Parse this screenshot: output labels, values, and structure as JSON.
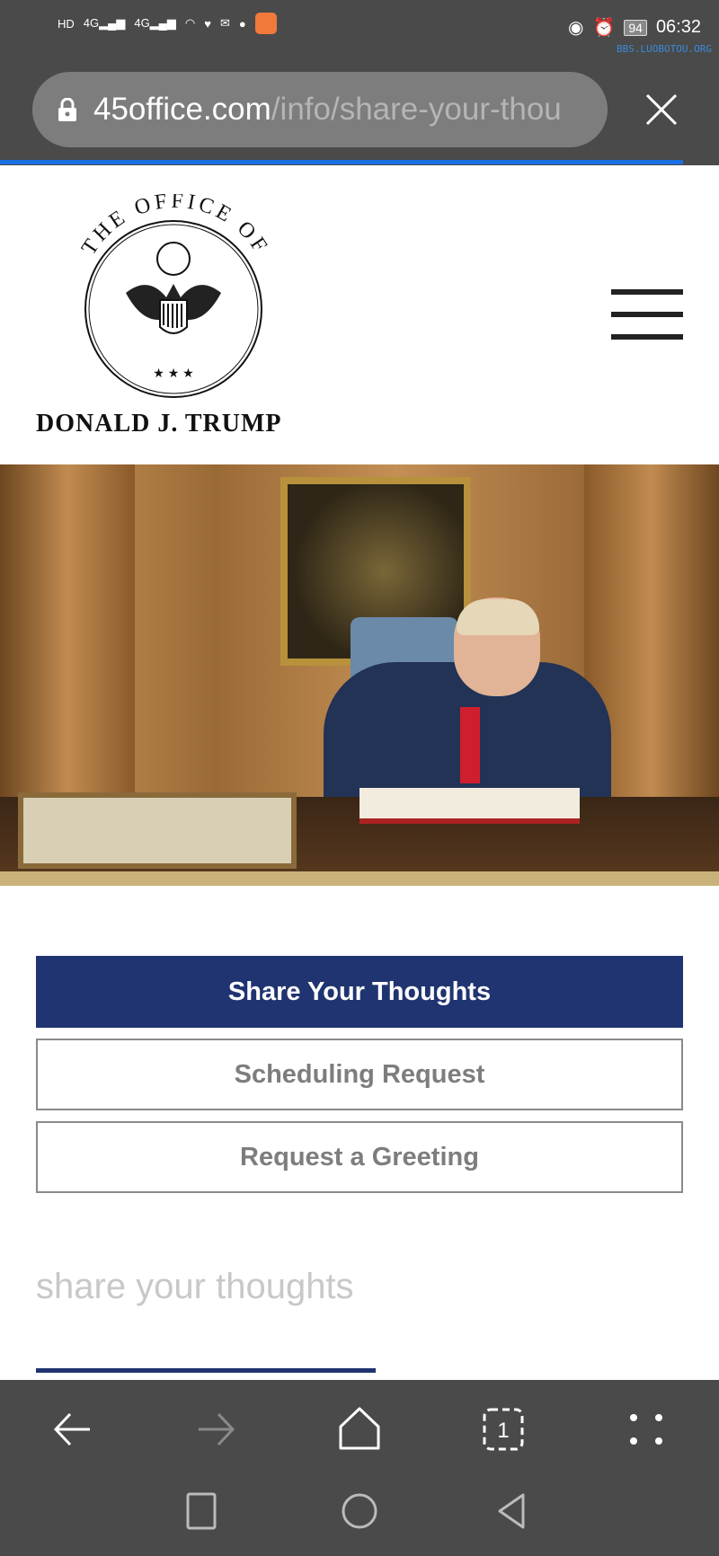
{
  "status_bar": {
    "left_icons": [
      "hd-icon",
      "signal-4g-icon",
      "signal-4g-icon",
      "wifi-icon",
      "health-icon",
      "mail-icon",
      "chat-icon",
      "app-icon"
    ],
    "battery": "94",
    "time": "06:32",
    "watermark": "BBS.LUOBOTOU.ORG"
  },
  "browser": {
    "url_host": "45office.com",
    "url_path": "/info/share-your-thou",
    "progress_percent": 95
  },
  "site": {
    "logo_top": "THE OFFICE OF",
    "logo_name": "DONALD J. TRUMP"
  },
  "tabs": [
    {
      "label": "Share Your Thoughts",
      "active": true
    },
    {
      "label": "Scheduling Request",
      "active": false
    },
    {
      "label": "Request a Greeting",
      "active": false
    }
  ],
  "section": {
    "title": "share your thoughts"
  },
  "colors": {
    "accent": "#1f3470",
    "chrome": "#4a4a4a",
    "progress": "#1a6fe0"
  }
}
